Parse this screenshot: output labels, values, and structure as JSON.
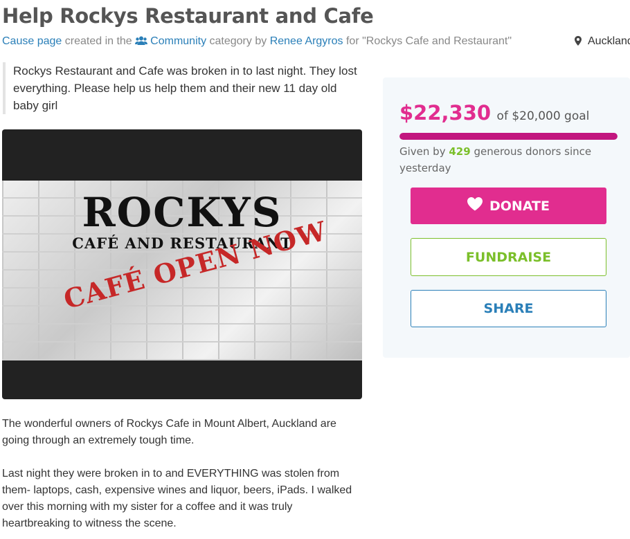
{
  "page": {
    "title": "Help Rockys Restaurant and Cafe"
  },
  "meta": {
    "cause_page": "Cause page",
    "created_in_the": "created in the",
    "category": "Community",
    "category_by": "category by",
    "author": "Renee Argyros",
    "for_text": "for \"Rockys Cafe and Restaurant\"",
    "location": "Auckland",
    "category_icon": "users-icon",
    "location_icon": "map-pin-icon"
  },
  "blurb": "Rockys Restaurant and Cafe was broken in to last night. They lost everything. Please help us help them and their new 11 day old baby girl",
  "media": {
    "logo_title": "ROCKYS",
    "logo_subtitle": "CAFÉ AND RESTAURANT",
    "logo_banner": "CAFÉ OPEN NOW"
  },
  "story": {
    "paragraph_1": "The wonderful owners of Rockys Cafe in Mount Albert, Auckland are going through an extremely tough time.",
    "paragraph_2": "Last night they were broken in to and EVERYTHING was stolen from them- laptops, cash, expensive wines and liquor, beers, iPads. I walked over this morning with my sister for a coffee and it was truly heartbreaking to witness the scene."
  },
  "fundraising": {
    "raised": "$22,330",
    "goal_text": "of $20,000 goal",
    "progress_fraction": 1.0,
    "given_by": "Given by",
    "donor_count": "429",
    "donors_suffix": "generous donors since yesterday",
    "donate_label": "DONATE",
    "fundraise_label": "FUNDRAISE",
    "share_label": "SHARE"
  },
  "colors": {
    "brand_pink": "#e12d8f",
    "progress_fill": "#c2167f",
    "green": "#7bbf2a",
    "link_blue": "#2a7fb8"
  }
}
